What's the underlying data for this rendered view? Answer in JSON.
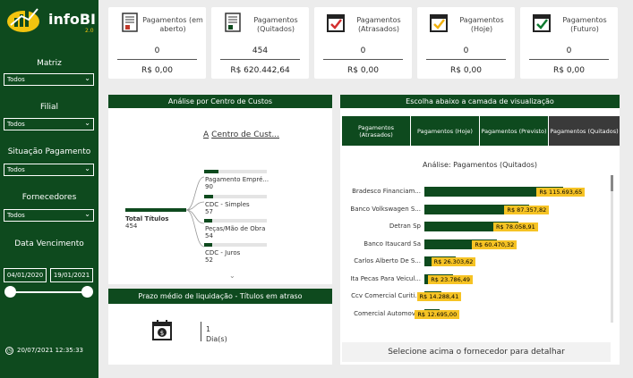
{
  "brand": {
    "name": "infoBI",
    "version": "2.0"
  },
  "sidebar": {
    "filters": [
      {
        "label": "Matriz",
        "value": "Todos"
      },
      {
        "label": "Filial",
        "value": "Todos"
      },
      {
        "label": "Situação Pagamento",
        "value": "Todos"
      },
      {
        "label": "Fornecedores",
        "value": "Todos"
      }
    ],
    "date_label": "Data Vencimento",
    "date_start": "04/01/2020",
    "date_end": "19/01/2021",
    "timestamp": "20/07/2021 12:35:33"
  },
  "kpis": [
    {
      "title": "Pagamentos (em aberto)",
      "count": "0",
      "value": "R$ 0,00",
      "icon": "document-icon"
    },
    {
      "title": "Pagamentos (Quitados)",
      "count": "454",
      "value": "R$ 620.442,64",
      "icon": "document-icon"
    },
    {
      "title": "Pagamentos (Atrasados)",
      "count": "0",
      "value": "R$ 0,00",
      "icon": "calendar-check-red-icon"
    },
    {
      "title": "Pagamentos (Hoje)",
      "count": "0",
      "value": "R$ 0,00",
      "icon": "calendar-check-yellow-icon"
    },
    {
      "title": "Pagamentos (Futuro)",
      "count": "0",
      "value": "R$ 0,00",
      "icon": "calendar-check-green-icon"
    }
  ],
  "cost_center": {
    "header": "Análise por Centro de Custos",
    "field": "Centro de Cust...",
    "root_label": "Total Títulos",
    "root_value": "454",
    "nodes": [
      {
        "label": "Pagamento Empré...",
        "value": "90"
      },
      {
        "label": "CDC - Simples",
        "value": "57"
      },
      {
        "label": "Peças/Mão de Obra",
        "value": "54"
      },
      {
        "label": "CDC - Juros",
        "value": "52"
      }
    ]
  },
  "prazo": {
    "header": "Prazo médio de liquidação - Títulos em atraso",
    "value": "1",
    "unit": "Dia(s)"
  },
  "layer": {
    "header": "Escolha abaixo a camada de visualização",
    "tabs": [
      {
        "label": "Pagamentos (Atrasados)",
        "active": false
      },
      {
        "label": "Pagamentos (Hoje)",
        "active": false
      },
      {
        "label": "Pagamentos (Previsto)",
        "active": false
      },
      {
        "label": "Pagamentos (Quitados)",
        "active": true
      }
    ],
    "chart_title": "Análise: Pagamentos (Quitados)",
    "footer": "Selecione acima o fornecedor para detalhar"
  },
  "chart_data": {
    "type": "bar",
    "title": "Análise: Pagamentos (Quitados)",
    "orientation": "horizontal",
    "categories": [
      "Bradesco Financiam...",
      "Banco Volkswagen S...",
      "Detran Sp",
      "Banco Itaucard Sa",
      "Carlos Alberto De S...",
      "Ita Pecas Para Veicul...",
      "Ccv Comercial Curiti...",
      "Comercial Automov..."
    ],
    "values": [
      115693.65,
      87357.82,
      78058.91,
      60470.32,
      26303.62,
      23786.49,
      14288.41,
      12695.0
    ],
    "value_labels": [
      "R$ 115.693,65",
      "R$ 87.357,82",
      "R$ 78.058,91",
      "R$ 60.470,32",
      "R$ 26.303,62",
      "R$ 23.786,49",
      "R$ 14.288,41",
      "R$ 12.695,00"
    ],
    "colors": {
      "bar": "#0e4a1e",
      "label": "#f6c324"
    }
  }
}
